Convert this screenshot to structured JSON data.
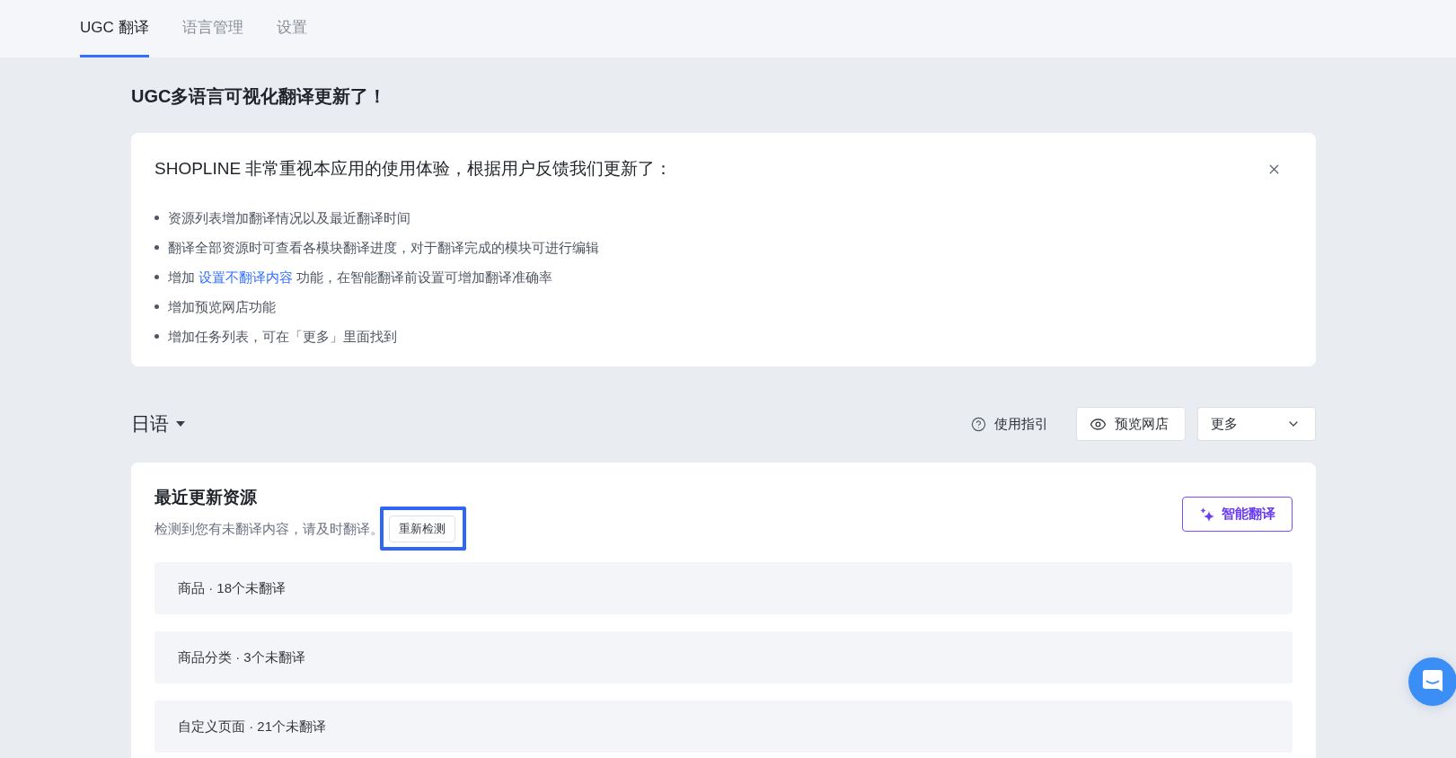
{
  "tabs": [
    {
      "label": "UGC 翻译",
      "selected": true
    },
    {
      "label": "语言管理",
      "selected": false
    },
    {
      "label": "设置",
      "selected": false
    }
  ],
  "page_title": "UGC多语言可视化翻译更新了！",
  "notice": {
    "heading": "SHOPLINE 非常重视本应用的使用体验，根据用户反馈我们更新了：",
    "items": [
      {
        "segments": [
          {
            "kind": "text",
            "text": "资源列表增加翻译情况以及最近翻译时间"
          }
        ]
      },
      {
        "segments": [
          {
            "kind": "text",
            "text": "翻译全部资源时可查看各模块翻译进度，对于翻译完成的模块可进行编辑"
          }
        ]
      },
      {
        "segments": [
          {
            "kind": "text",
            "text": "增加 "
          },
          {
            "kind": "link",
            "text": "设置不翻译内容"
          },
          {
            "kind": "text",
            "text": " 功能，在智能翻译前设置可增加翻译准确率"
          }
        ]
      },
      {
        "segments": [
          {
            "kind": "text",
            "text": "增加预览网店功能"
          }
        ]
      },
      {
        "segments": [
          {
            "kind": "text",
            "text": "增加任务列表，可在「更多」里面找到"
          }
        ]
      }
    ]
  },
  "language_select": {
    "value": "日语"
  },
  "toolbar": {
    "help": "使用指引",
    "preview_button": "预览网店",
    "more_select": "更多"
  },
  "recent": {
    "title": "最近更新资源",
    "description": "检测到您有未翻译内容，请及时翻译。",
    "recheck_button": {
      "label": "重新检测",
      "highlighted": true
    },
    "ai_button": "智能翻译",
    "rows": [
      {
        "label": "商品 · 18个未翻译"
      },
      {
        "label": "商品分类 · 3个未翻译"
      },
      {
        "label": "自定义页面 · 21个未翻译"
      }
    ]
  }
}
